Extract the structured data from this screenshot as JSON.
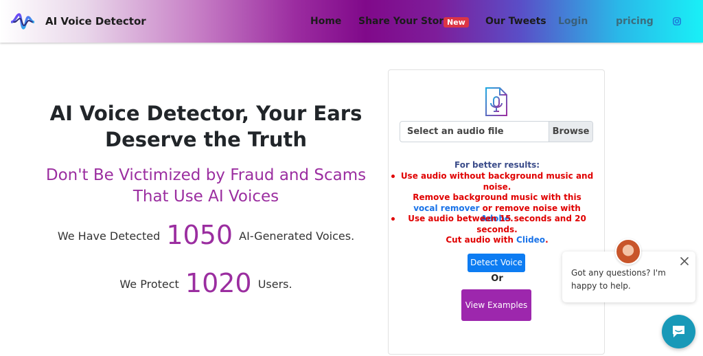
{
  "nav": {
    "brand": "AI Voice Detector",
    "home": "Home",
    "story": "Share Your Story",
    "story_badge": "New",
    "tweets": "Our Tweets",
    "login": "Login",
    "pricing": "pricing"
  },
  "hero": {
    "title_bold": "AI Voice Detector,",
    "title_rest": " Your Ears Deserve the Truth",
    "subtitle": "Don't Be Victimized by Fraud and Scams That Use AI Voices",
    "detected_prefix": "We Have Detected",
    "detected_count": "1050",
    "detected_suffix": "AI-Generated Voices.",
    "protect_prefix": "We Protect",
    "protect_count": "1020",
    "protect_suffix": "Users."
  },
  "upload": {
    "file_label": "Select an audio file",
    "browse_label": "Browse",
    "tips_heading": "For better results:",
    "tip1": "Use audio without background music and noise.",
    "tip2_a": "Remove background music with this ",
    "tip2_link1": "vocal remover",
    "tip2_b": " or remove noise with ",
    "tip2_link2": "Adobe",
    "tip2_c": ".",
    "tip3": "Use audio between 15 seconds and 20 seconds.",
    "tip4_a": "Cut audio with ",
    "tip4_link": "Clideo",
    "tip4_b": ".",
    "detect_button": "Detect Voice",
    "or_text": "Or",
    "examples_button": "View Examples"
  },
  "chat": {
    "message": "Got any questions? I'm happy to help."
  },
  "colors": {
    "accent_purple": "#9b2ea0",
    "detect_blue": "#0d7cf2",
    "tip_red": "#e00000",
    "link_blue": "#1a73e8",
    "chat_teal": "#1999b8"
  },
  "icons": [
    "brand-waveform-icon",
    "instagram-icon",
    "audio-file-icon",
    "close-icon",
    "chat-icon"
  ]
}
